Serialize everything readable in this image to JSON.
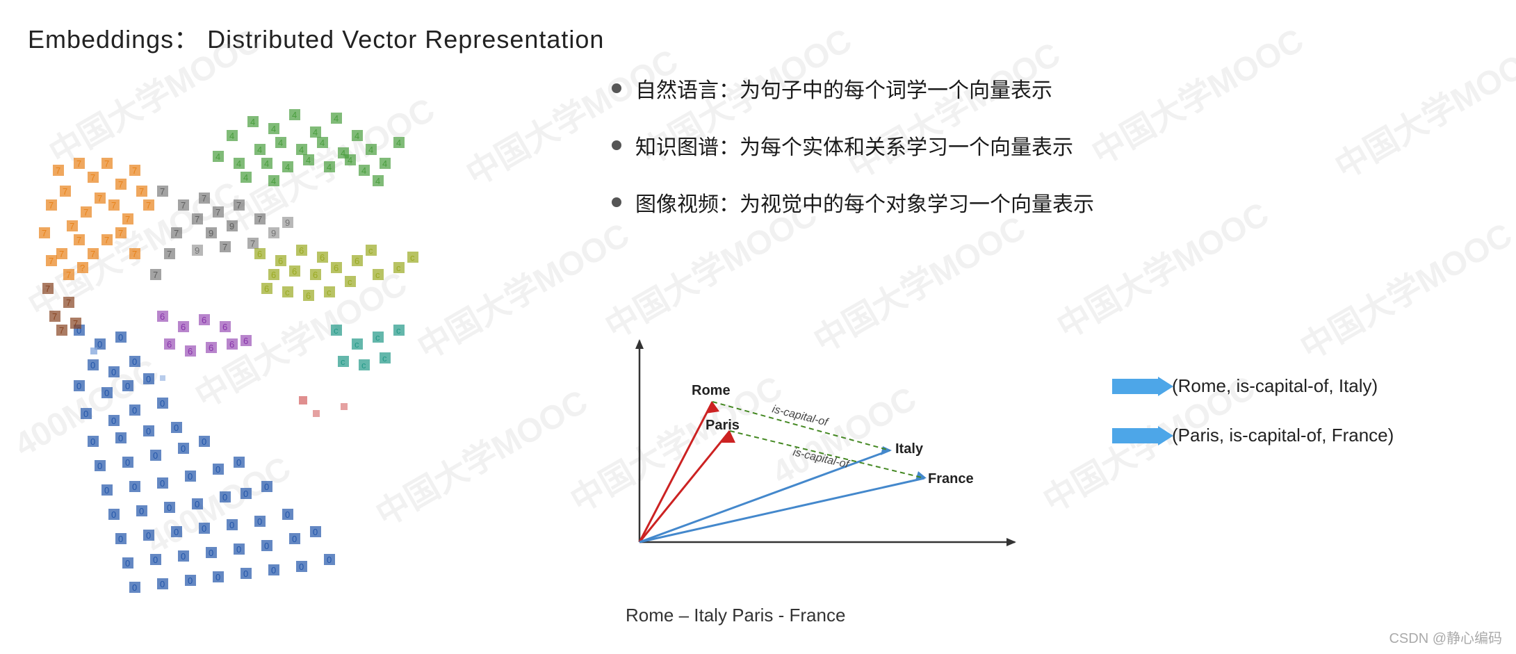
{
  "page": {
    "title": "Embeddings：  Distributed Vector Representation",
    "background": "#ffffff"
  },
  "watermarks": [
    "中国大学MOOC",
    "中国大学MOOC",
    "中国大学MOOC",
    "中国大学MOOC",
    "中国大学MOOC",
    "中国大学MOOC",
    "400MOOC",
    "400MOOC"
  ],
  "bullets": [
    {
      "text": "自然语言：为句子中的每个词学一个向量表示"
    },
    {
      "text": "知识图谱：为每个实体和关系学习一个向量表示"
    },
    {
      "text": "图像视频：为视觉中的每个对象学习一个向量表示"
    }
  ],
  "vector_labels": {
    "rome": "Rome",
    "paris": "Paris",
    "italy": "Italy",
    "france": "France",
    "is_capital_of_1": "is-capital-of",
    "is_capital_of_2": "is-capital-of"
  },
  "legend": [
    {
      "label": "(Rome, is-capital-of, Italy)"
    },
    {
      "label": "(Paris,  is-capital-of, France)"
    }
  ],
  "caption": "Rome – Italy  Paris - France",
  "footer": "CSDN @静心编码"
}
